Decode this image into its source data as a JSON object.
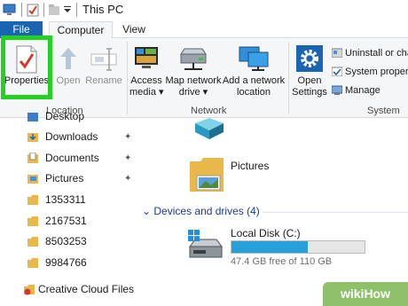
{
  "window": {
    "title": "This PC"
  },
  "tabs": {
    "file": "File",
    "computer": "Computer",
    "view": "View"
  },
  "ribbon": {
    "location": {
      "group_label": "Location",
      "properties": "Properties",
      "open": "Open",
      "rename": "Rename"
    },
    "network": {
      "group_label": "Network",
      "access_media_line1": "Access",
      "access_media_line2": "media ▾",
      "map_drive_line1": "Map network",
      "map_drive_line2": "drive ▾",
      "add_location_line1": "Add a network",
      "add_location_line2": "location"
    },
    "system": {
      "group_label": "System",
      "open_settings_line1": "Open",
      "open_settings_line2": "Settings",
      "uninstall": "Uninstall or cha",
      "system_properties": "System propert",
      "manage": "Manage"
    }
  },
  "nav": {
    "partial_top": "Desktop",
    "items": [
      "Downloads",
      "Documents",
      "Pictures",
      "1353311",
      "2167531",
      "8503253",
      "9984766"
    ],
    "creative_cloud": "Creative Cloud Files"
  },
  "content": {
    "pictures_label": "Pictures",
    "devices_header": "Devices and drives (4)",
    "disk_label": "Local Disk (C:)",
    "disk_free": "47.4 GB free of 110 GB",
    "disk_used_fraction": 0.57
  },
  "watermark": "wikiHow",
  "colors": {
    "file_tab": "#1a64b4",
    "highlight": "#22d122",
    "disk_fill": "#26a0da",
    "folder": "#e8b84a"
  }
}
